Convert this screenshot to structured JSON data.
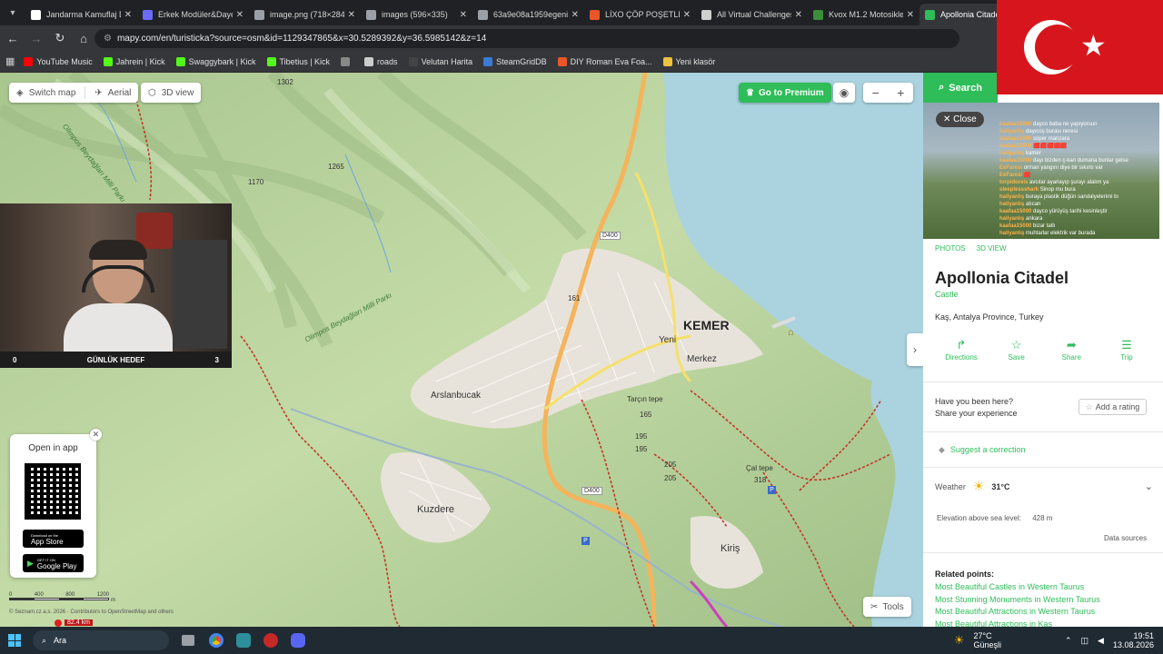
{
  "tabs": [
    {
      "title": "Jandarma Kamuflaj Dı",
      "color": "#ffffff",
      "active": false
    },
    {
      "title": "Erkek Modüler&Daye",
      "color": "#6b6bff",
      "active": false
    },
    {
      "title": "image.png (718×284)",
      "color": "#9aa0a6",
      "active": false
    },
    {
      "title": "images (596×335)",
      "color": "#9aa0a6",
      "active": false
    },
    {
      "title": "63a9e08a1959egenip",
      "color": "#9aa0a6",
      "active": false
    },
    {
      "title": "LİXO ÇÖP POŞETLER",
      "color": "#e8562a",
      "active": false
    },
    {
      "title": "All Virtual Challenges",
      "color": "#cfcfcf",
      "active": false
    },
    {
      "title": "Kvox M1.2 Motosikle",
      "color": "#3c8c3c",
      "active": false
    },
    {
      "title": "Apollonia Citadel",
      "color": "#2ebd59",
      "active": true
    }
  ],
  "url": "mapy.com/en/turisticka?source=osm&id=1129347865&x=30.5289392&y=36.5985142&z=14",
  "bookmarks": [
    {
      "label": "YouTube Music",
      "color": "#ff0000"
    },
    {
      "label": "Jahrein | Kick",
      "color": "#53fc18"
    },
    {
      "label": "Swaggybark | Kick",
      "color": "#53fc18"
    },
    {
      "label": "Tibetius | Kick",
      "color": "#53fc18"
    },
    {
      "label": "",
      "color": "#888888"
    },
    {
      "label": "roads",
      "color": "#cccccc"
    },
    {
      "label": "Velutan Harita",
      "color": "#444444"
    },
    {
      "label": "SteamGridDB",
      "color": "#3a7bd5"
    },
    {
      "label": "DIY Roman Eva Foa...",
      "color": "#e8562a"
    },
    {
      "label": "Yeni klasör",
      "color": "#f0c040"
    }
  ],
  "map": {
    "switch_map": "Switch map",
    "aerial": "Aerial",
    "view3d": "3D view",
    "premium": "Go to Premium",
    "tools": "Tools",
    "open_in_app": "Open in app",
    "app_store": "App Store",
    "google_play": "Google Play",
    "app_store_small": "Download on the",
    "google_play_small": "GET IT ON",
    "scale_labels": [
      "0",
      "400",
      "800",
      "1200"
    ],
    "scale_unit": "m",
    "attribution": "© Seznam.cz a.s. 2026 · Contributors to OpenStreetMap and others",
    "distance": "82.4 km",
    "places": [
      "KEMER",
      "Yeni",
      "Merkez",
      "Arslanbucak",
      "Kuzdere",
      "Kiriş",
      "Tarçın tepe",
      "Çal tepe"
    ],
    "park_labels": [
      "Olimpos Beydağları Milli Parkı",
      "Olimpos Beydağları Milli Parkı"
    ],
    "road_labels": [
      "D400",
      "D400"
    ],
    "peaks": [
      "1302",
      "1265",
      "1170",
      "161",
      "165",
      "195",
      "195",
      "205",
      "205",
      "318"
    ]
  },
  "stream": {
    "goal_left": "0",
    "goal_title": "GÜNLÜK HEDEF",
    "goal_right": "3",
    "chat": [
      {
        "user": "kaafaa15000",
        "text": "dayco baba ne yapıyorsun"
      },
      {
        "user": "haliyanlış",
        "text": "dayıcoş burası neresi"
      },
      {
        "user": "kaafaa15000",
        "text": "süper manzara"
      },
      {
        "user": "kaafaa15000",
        "text": "🟥🟥🟥🟥🟥"
      },
      {
        "user": "haliyanlış",
        "text": "kamer"
      },
      {
        "user": "kaafaa15000",
        "text": "dayı bizden ç-kan dumana bunlar gelse"
      },
      {
        "user": "EeFaresi",
        "text": "orman yangını diye bir sıkıntı var"
      },
      {
        "user": "EeFaresi",
        "text": "🟥"
      },
      {
        "user": "torpidoreis",
        "text": "avcılar ayarlayıp şurayı alalım ya"
      },
      {
        "user": "sleeplessshark",
        "text": "Sinop mu bura"
      },
      {
        "user": "haliyanlış",
        "text": "buraya plastik düğün sandalyelerimi bı"
      },
      {
        "user": "haliyanlış",
        "text": "atıcan"
      },
      {
        "user": "kaafaa15000",
        "text": "dayco yürüyüş tarihi kesinleştir"
      },
      {
        "user": "haliyanlış",
        "text": "ankara"
      },
      {
        "user": "kaafaa15000",
        "text": "bizar tatlı"
      },
      {
        "user": "haliyanlış",
        "text": "muhtarlar elektrik var burada"
      }
    ]
  },
  "panel": {
    "search": "Search",
    "close": "Close",
    "photos": "PHOTOS",
    "view3d": "3D VIEW",
    "title": "Apollonia Citadel",
    "category": "Castle",
    "location": "Kaş, Antalya Province, Turkey",
    "actions": [
      {
        "label": "Directions",
        "icon": "directions-icon"
      },
      {
        "label": "Save",
        "icon": "star-icon"
      },
      {
        "label": "Share",
        "icon": "share-icon"
      },
      {
        "label": "Trip",
        "icon": "trip-icon"
      }
    ],
    "been_here": "Have you been here?",
    "share_exp": "Share your experience",
    "add_rating": "Add a rating",
    "suggest": "Suggest a correction",
    "weather_label": "Weather",
    "weather_temp": "31°C",
    "elevation_label": "Elevation above sea level:",
    "elevation_value": "428 m",
    "data_sources": "Data sources",
    "related_title": "Related points:",
    "related": [
      "Most Beautiful Castles in Western Taurus",
      "Most Stunning Monuments in Western Taurus",
      "Most Beautiful Attractions in Western Taurus",
      "Most Beautiful Attractions in Kaş"
    ]
  },
  "taskbar": {
    "search": "Ara",
    "weather_temp": "27°C",
    "weather_desc": "Güneşli",
    "time": "19:51",
    "date": "13.08.2026"
  }
}
